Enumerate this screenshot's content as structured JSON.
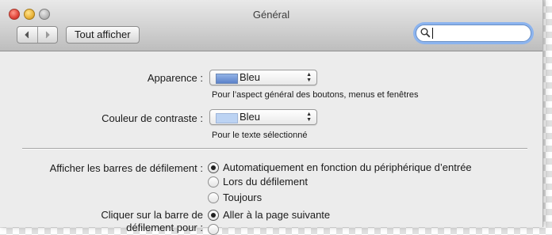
{
  "window": {
    "title": "Général"
  },
  "toolbar": {
    "back_icon": "chevron-left-icon",
    "forward_icon": "chevron-right-icon",
    "show_all_label": "Tout afficher",
    "search_value": ""
  },
  "appearance": {
    "label": "Apparence :",
    "value": "Bleu",
    "swatch_color": "#6b8fd1",
    "hint": "Pour l’aspect général des boutons, menus et fenêtres"
  },
  "highlight": {
    "label": "Couleur de contraste :",
    "value": "Bleu",
    "swatch_color": "#bcd3f3",
    "hint": "Pour le texte sélectionné"
  },
  "scrollbars": {
    "label": "Afficher les barres de défilement :",
    "options": [
      {
        "label": "Automatiquement en fonction du périphérique d’entrée",
        "selected": true
      },
      {
        "label": "Lors du défilement",
        "selected": false
      },
      {
        "label": "Toujours",
        "selected": false
      }
    ]
  },
  "click_scrollbar": {
    "label_line1": "Cliquer sur la barre de",
    "label_line2": "défilement pour :",
    "options": [
      {
        "label": "Aller à la page suivante",
        "selected": true
      },
      {
        "label": "",
        "selected": false
      }
    ]
  }
}
